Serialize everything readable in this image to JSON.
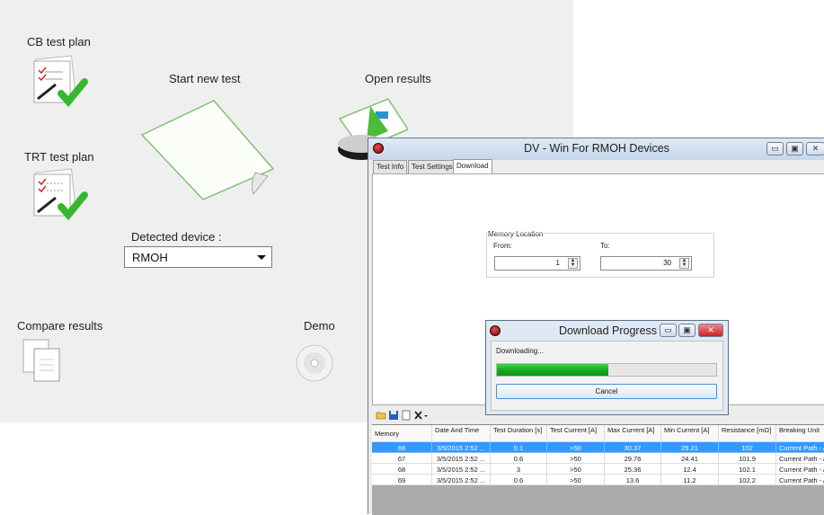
{
  "launcher": {
    "cb_test_plan": "CB test plan",
    "trt_test_plan": "TRT test plan",
    "start_new_test": "Start new test",
    "open_results": "Open results",
    "detected_device_label": "Detected device :",
    "detected_device_value": "RMOH",
    "compare_results": "Compare results",
    "demo": "Demo"
  },
  "window": {
    "title": "DV - Win For RMOH Devices",
    "controls": {
      "minimize": "▭",
      "maximize": "▣",
      "close": "✕"
    },
    "tabs": [
      {
        "label": "Test Info",
        "active": false
      },
      {
        "label": "Test Settings",
        "active": false
      },
      {
        "label": "Download",
        "active": true
      }
    ],
    "memory_location": {
      "group_label": "Memory Location",
      "from_label": "From:",
      "from_value": "1",
      "to_label": "To:",
      "to_value": "30"
    }
  },
  "progress_dialog": {
    "title": "Download Progress",
    "message": "Downloading...",
    "progress_fraction": 0.51,
    "cancel_label": "Cancel"
  },
  "toolbar": {
    "icons": [
      "open-folder-icon",
      "save-icon",
      "document-icon",
      "delete-icon"
    ]
  },
  "grid": {
    "columns": [
      "Memory",
      "Date And Time",
      "Test Duration [s]",
      "Test Current [A]",
      "Max Current [A]",
      "Min Current [A]",
      "Resistance [mΩ]",
      "Breaking Unit"
    ],
    "rows": [
      [
        "66",
        "3/5/2015 2:52 ...",
        "0.1",
        ">50",
        "30.37",
        "29.21",
        "102",
        "Current Path - A"
      ],
      [
        "67",
        "3/5/2015 2:52 ...",
        "0.6",
        ">50",
        "29.76",
        "24.41",
        "101.9",
        "Current Path - A"
      ],
      [
        "68",
        "3/5/2015 2:52 ...",
        "3",
        ">50",
        "25.36",
        "12.4",
        "102.1",
        "Current Path - A"
      ],
      [
        "69",
        "3/5/2015 2:52 ...",
        "0.6",
        ">50",
        "13.6",
        "11.2",
        "102.2",
        "Current Path - A"
      ]
    ],
    "selected_row": 0
  },
  "colors": {
    "selection": "#3399ff",
    "progress": "#12a61f",
    "check": "#36b82e"
  }
}
